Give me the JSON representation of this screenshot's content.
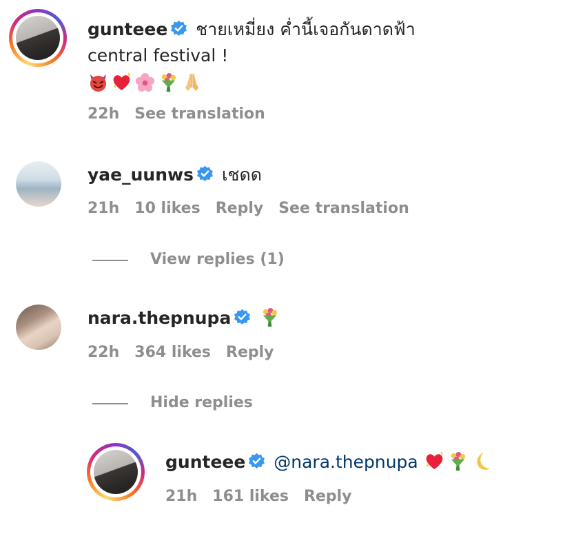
{
  "comments": [
    {
      "username": "gunteee",
      "text_line1": "ชายเหมี่ยง ค่ำนี้เจอกันดาดฟ้า",
      "text_line2": "central festival !",
      "emojis": [
        "smiling-devil",
        "sparkling-heart",
        "cherry-blossom",
        "bouquet",
        "folded-hands"
      ],
      "time": "22h",
      "see_translation": "See translation"
    },
    {
      "username": "yae_uunws",
      "text": "เชดด",
      "time": "21h",
      "likes": "10 likes",
      "reply": "Reply",
      "see_translation": "See translation",
      "view_replies": "View replies (1)"
    },
    {
      "username": "nara.thepnupa",
      "emojis": [
        "bouquet"
      ],
      "time": "22h",
      "likes": "364 likes",
      "reply": "Reply",
      "hide_replies": "Hide replies",
      "replies": [
        {
          "username": "gunteee",
          "mention": "@nara.thepnupa",
          "emojis": [
            "sparkling-heart",
            "bouquet",
            "crescent-moon"
          ],
          "time": "21h",
          "likes": "161 likes",
          "reply": "Reply"
        }
      ]
    }
  ],
  "colors": {
    "verified": "#3897f0",
    "meta_text": "#8e8e8e",
    "mention": "#00376b",
    "text": "#262626"
  }
}
